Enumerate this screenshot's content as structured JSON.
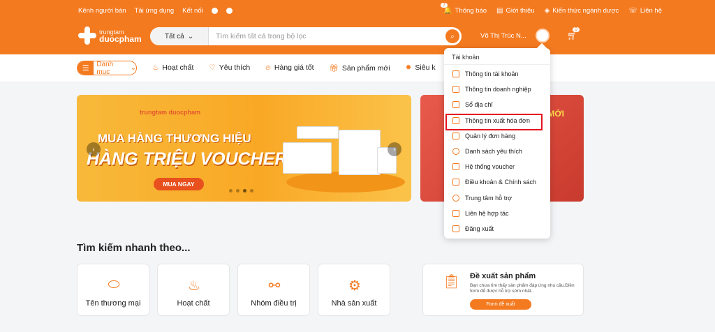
{
  "colors": {
    "brand": "#f47a20",
    "highlight": "#e5141f"
  },
  "topbar": {
    "links": [
      "Kênh người bán",
      "Tải ứng dụng",
      "Kết nối"
    ],
    "right": [
      {
        "label": "Thông báo",
        "icon": "bell-icon",
        "badge": "7"
      },
      {
        "label": "Giới thiệu",
        "icon": "info-doc-icon"
      },
      {
        "label": "Kiến thức ngành dược",
        "icon": "pill-icon"
      },
      {
        "label": "Liên hệ",
        "icon": "phone-icon"
      }
    ]
  },
  "logo": {
    "line1": "trungtam",
    "line2": "duocpham"
  },
  "search": {
    "category": "Tất cả",
    "placeholder": "Tìm kiếm tất cả trong bộ lọc"
  },
  "user": {
    "name": "Võ Thị Trúc N...",
    "cart_count": "0"
  },
  "nav": {
    "category_button": "Danh mục",
    "items": [
      {
        "label": "Hoạt chất",
        "icon": "mortar-icon"
      },
      {
        "label": "Yêu thích",
        "icon": "heart-icon"
      },
      {
        "label": "Hàng giá tốt",
        "icon": "fire-icon"
      },
      {
        "label": "Sản phẩm mới",
        "icon": "gift-icon"
      },
      {
        "label": "Siêu k",
        "icon": "star-icon"
      }
    ]
  },
  "banner": {
    "brand": "trungtam duocpham",
    "line1": "MUA HÀNG THƯƠNG HIỆU",
    "line2": "HÀNG TRIỆU VOUCHER",
    "cta": "MUA NGAY",
    "side_text": "MỚI"
  },
  "account_menu": {
    "title": "Tài khoản",
    "items": [
      {
        "label": "Thông tin tài khoản",
        "icon": "user-icon"
      },
      {
        "label": "Thông tin doanh nghiệp",
        "icon": "car-icon"
      },
      {
        "label": "Sổ địa chỉ",
        "icon": "book-icon"
      },
      {
        "label": "Thông tin xuất hóa đơn",
        "icon": "invoice-icon",
        "highlighted": true
      },
      {
        "label": "Quản lý đơn hàng",
        "icon": "doc-icon"
      },
      {
        "label": "Danh sách yêu thích",
        "icon": "heart-icon"
      },
      {
        "label": "Hệ thống voucher",
        "icon": "voucher-icon"
      },
      {
        "label": "Điều khoản & Chính sách",
        "icon": "policy-icon"
      },
      {
        "label": "Trung tâm hỗ trợ",
        "icon": "support-icon"
      },
      {
        "label": "Liên hệ hợp tác",
        "icon": "phone-icon"
      },
      {
        "label": "Đăng xuất",
        "icon": "logout-icon"
      }
    ]
  },
  "quick_search": {
    "title": "Tìm kiếm nhanh theo...",
    "cards": [
      {
        "label": "Tên thương mại",
        "icon": "capsule-icon"
      },
      {
        "label": "Hoạt chất",
        "icon": "mortar-icon"
      },
      {
        "label": "Nhóm điều trị",
        "icon": "molecule-icon"
      },
      {
        "label": "Nhà sản xuất",
        "icon": "factory-gear-icon"
      }
    ]
  },
  "propose": {
    "title": "Đề xuất sản phẩm",
    "desc": "Bạn chưa tìm thấy sản phẩm đáp ứng nhu cầu.Điền form để được hỗ trợ sớm nhất..",
    "button": "Form đề xuất"
  }
}
